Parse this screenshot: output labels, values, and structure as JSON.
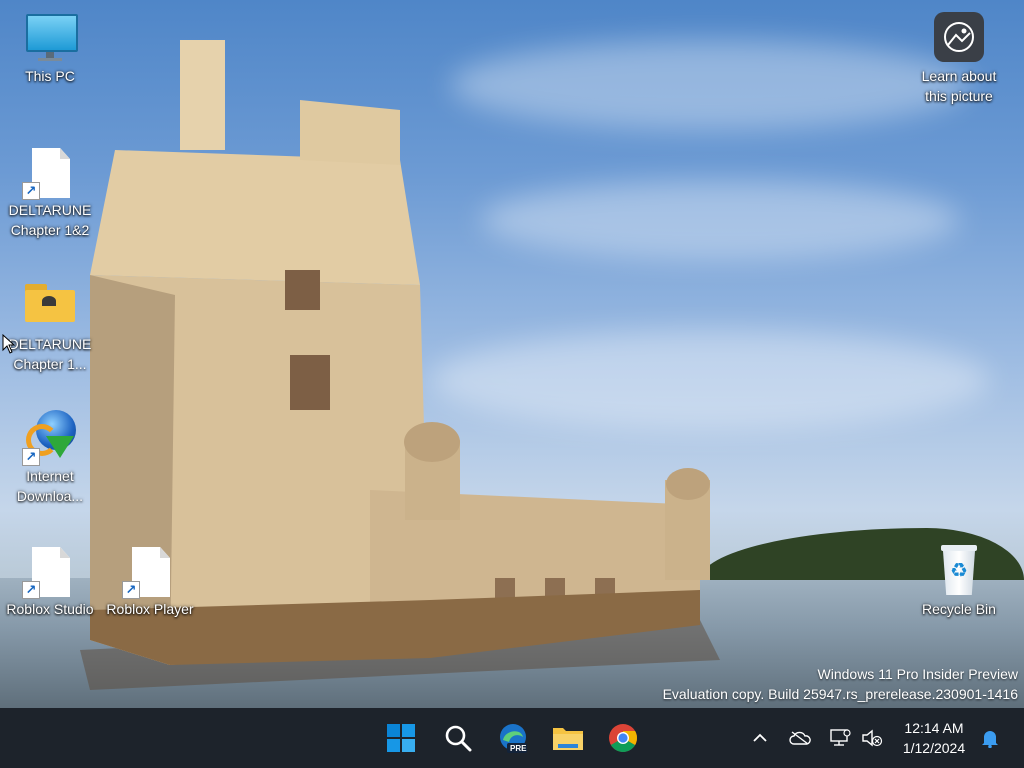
{
  "desktop": {
    "icons": [
      {
        "label": "This PC",
        "icon": "monitor-icon"
      },
      {
        "label": "DELTARUNE Chapter 1&2",
        "icon": "file-shortcut-icon"
      },
      {
        "label": "DELTARUNE Chapter 1...",
        "icon": "folder-icon"
      },
      {
        "label": "Internet Downloa...",
        "icon": "internet-download-manager-icon"
      },
      {
        "label": "Roblox Studio",
        "icon": "file-shortcut-icon"
      },
      {
        "label": "Roblox Player",
        "icon": "file-shortcut-icon"
      },
      {
        "label": "Learn about this picture",
        "icon": "camera-icon"
      },
      {
        "label": "Recycle Bin",
        "icon": "recycle-bin-icon"
      }
    ],
    "watermark": {
      "line1": "Windows 11 Pro Insider Preview",
      "line2": "Evaluation copy. Build 25947.rs_prerelease.230901-1416"
    }
  },
  "taskbar": {
    "apps": [
      {
        "name": "Start",
        "icon": "windows-start-icon"
      },
      {
        "name": "Search",
        "icon": "search-icon"
      },
      {
        "name": "Microsoft Edge",
        "icon": "edge-icon",
        "badge": "PRE"
      },
      {
        "name": "File Explorer",
        "icon": "folder-icon"
      },
      {
        "name": "Google Chrome",
        "icon": "chrome-icon"
      }
    ],
    "tray": {
      "icons": [
        "chevron-up-icon",
        "onedrive-icon",
        "network-icon",
        "volume-muted-icon"
      ],
      "time": "12:14 AM",
      "date": "1/12/2024",
      "notification_icon": "bell-icon"
    }
  },
  "colors": {
    "taskbar_bg": "#1d232b",
    "win_blue": "#0a84d6",
    "folder_yellow": "#f5c342"
  }
}
